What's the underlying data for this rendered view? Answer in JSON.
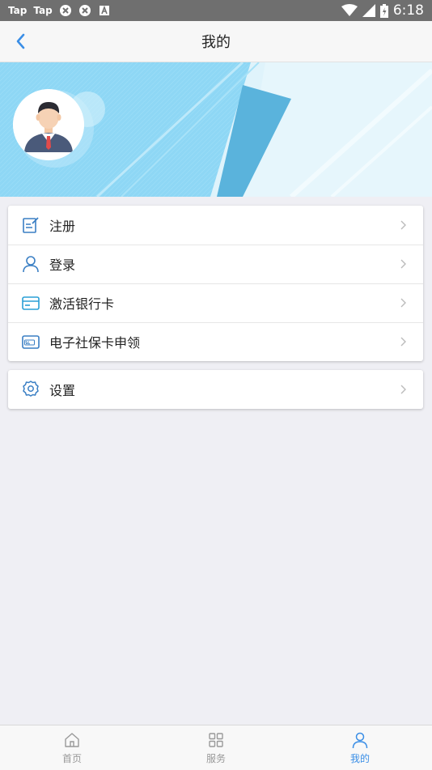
{
  "status_bar": {
    "left_labels": [
      "Tap",
      "Tap"
    ],
    "time": "6:18",
    "icons": [
      "tap-app-icon",
      "tap-app-icon",
      "vpn-icon",
      "vpn-icon",
      "a-notification-icon",
      "wifi-icon",
      "cellular-signal-icon",
      "battery-charging-icon"
    ]
  },
  "header": {
    "title": "我的",
    "back_icon": "back-chevron-icon"
  },
  "banner": {
    "avatar_icon": "person-avatar-icon"
  },
  "menu_group_1": [
    {
      "label": "注册",
      "icon": "register-edit-icon"
    },
    {
      "label": "登录",
      "icon": "user-icon"
    },
    {
      "label": "激活银行卡",
      "icon": "bank-card-icon"
    },
    {
      "label": "电子社保卡申领",
      "icon": "social-security-card-icon"
    }
  ],
  "menu_group_2": [
    {
      "label": "设置",
      "icon": "gear-icon"
    }
  ],
  "tabbar": {
    "tabs": [
      {
        "label": "首页",
        "icon": "home-icon",
        "active": false
      },
      {
        "label": "服务",
        "icon": "grid-icon",
        "active": false
      },
      {
        "label": "我的",
        "icon": "user-icon",
        "active": true
      }
    ]
  },
  "colors": {
    "accent": "#3a8ee6",
    "banner_light": "#8ed7f5",
    "banner_dark": "#5ab3dc",
    "status_bar": "#6f6f6f"
  }
}
